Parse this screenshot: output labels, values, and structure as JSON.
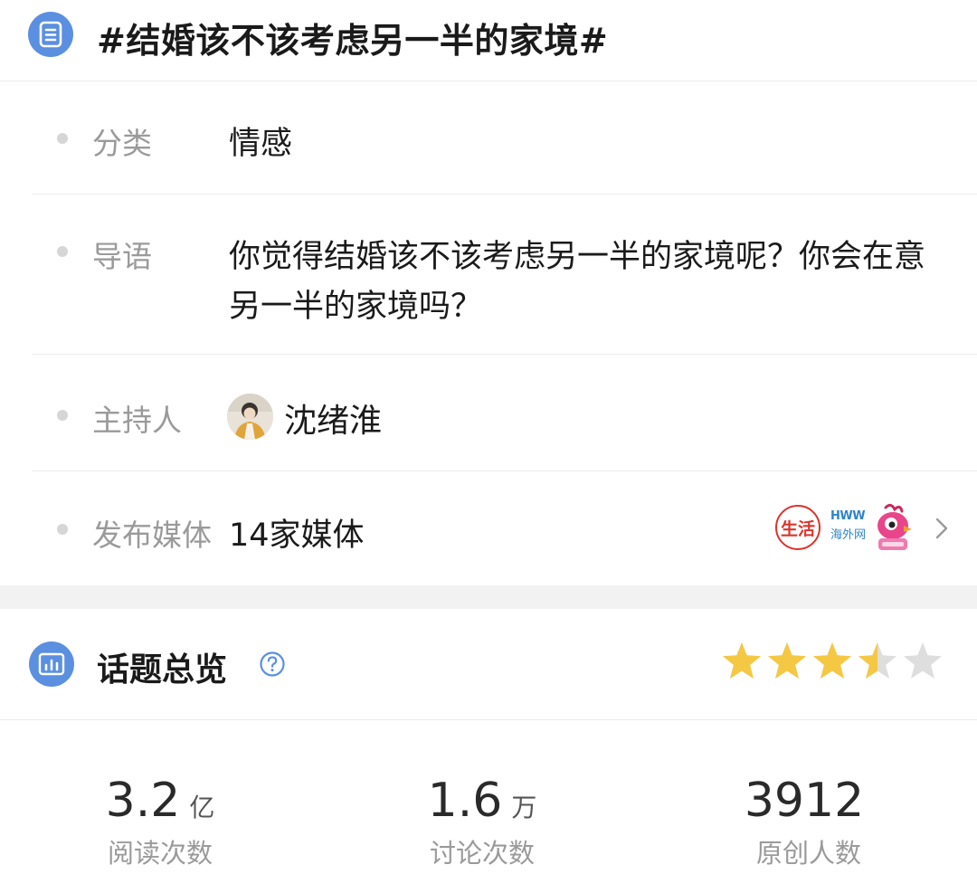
{
  "topic": {
    "title": "#结婚该不该考虑另一半的家境#",
    "icon": "list-icon"
  },
  "info": {
    "category": {
      "label": "分类",
      "value": "情感"
    },
    "intro": {
      "label": "导语",
      "value": "你觉得结婚该不该考虑另一半的家境呢？你会在意另一半的家境吗？"
    },
    "host": {
      "label": "主持人",
      "name": "沈绪淮",
      "avatar": "avatar-icon"
    },
    "media": {
      "label": "发布媒体",
      "value": "14家媒体",
      "logos": [
        {
          "name": "life-media-logo",
          "text": "生活"
        },
        {
          "name": "hww-logo",
          "text_top": "HWW",
          "text_bottom": "海外网"
        },
        {
          "name": "bird-mascot-logo"
        }
      ]
    }
  },
  "overview": {
    "title": "话题总览",
    "help_icon": "question-circle-icon",
    "rating": {
      "value": 3.5,
      "max": 5
    }
  },
  "stats": [
    {
      "number": "3.2",
      "unit": "亿",
      "label": "阅读次数"
    },
    {
      "number": "1.6",
      "unit": "万",
      "label": "讨论次数"
    },
    {
      "number": "3912",
      "unit": "",
      "label": "原创人数"
    }
  ],
  "colors": {
    "accent_blue": "#5b8fe0",
    "star_gold": "#f5c843",
    "star_empty": "#dedede",
    "label_gray": "#9a9a9a",
    "life_red": "#d9352c",
    "hww_blue": "#2d84c8"
  }
}
